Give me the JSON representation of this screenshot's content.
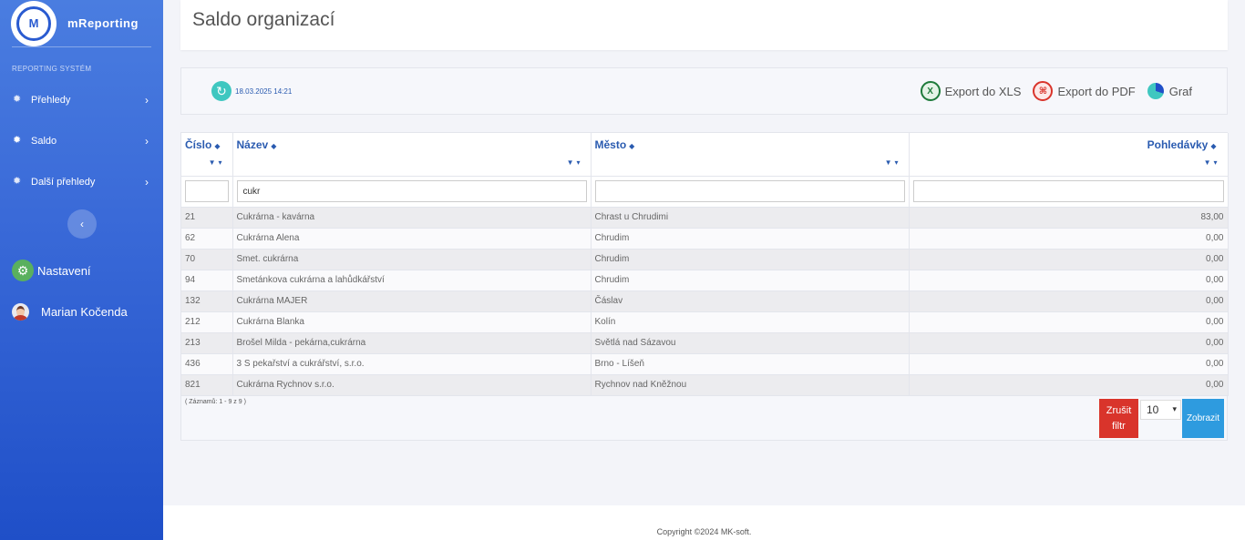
{
  "sidebar": {
    "brand": "mReporting",
    "logo_letter": "M",
    "section": "REPORTING SYSTÉM",
    "items": [
      {
        "label": "Přehledy"
      },
      {
        "label": "Saldo"
      },
      {
        "label": "Další přehledy"
      }
    ],
    "settings_label": "Nastavení",
    "user_name": "Marian Kočenda"
  },
  "header": {
    "title": "Saldo organizací"
  },
  "toolbar": {
    "timestamp": "18.03.2025 14:21",
    "export_xls": "Export do XLS",
    "export_pdf": "Export do PDF",
    "graph": "Graf"
  },
  "table": {
    "columns": [
      "Číslo",
      "Název",
      "Město",
      "Pohledávky"
    ],
    "filters": {
      "cislo": "",
      "nazev": "cukr",
      "mesto": "",
      "pohledavky": ""
    },
    "rows": [
      [
        "21",
        "Cukrárna - kavárna",
        "Chrast u Chrudimi",
        "83,00"
      ],
      [
        "62",
        "Cukrárna Alena",
        "Chrudim",
        "0,00"
      ],
      [
        "70",
        "Smet. cukrárna",
        "Chrudim",
        "0,00"
      ],
      [
        "94",
        "Smetánkova cukrárna a lahůdkářství",
        "Chrudim",
        "0,00"
      ],
      [
        "132",
        "Cukrárna MAJER",
        "Čáslav",
        "0,00"
      ],
      [
        "212",
        "Cukrárna Blanka",
        "Kolín",
        "0,00"
      ],
      [
        "213",
        "Brošel Milda - pekárna,cukrárna",
        "Světlá nad Sázavou",
        "0,00"
      ],
      [
        "436",
        "3 S pekařství a cukrářství, s.r.o.",
        "Brno - Líšeň",
        "0,00"
      ],
      [
        "821",
        "Cukrárna Rychnov s.r.o.",
        "Rychnov nad Kněžnou",
        "0,00"
      ]
    ],
    "records_info": "( Záznamů: 1 - 9 z 9 )",
    "reset_label": "Zrušit filtr",
    "page_size": "10",
    "show_label": "Zobrazit"
  },
  "footer": {
    "copyright": "Copyright ©2024 MK-soft."
  }
}
